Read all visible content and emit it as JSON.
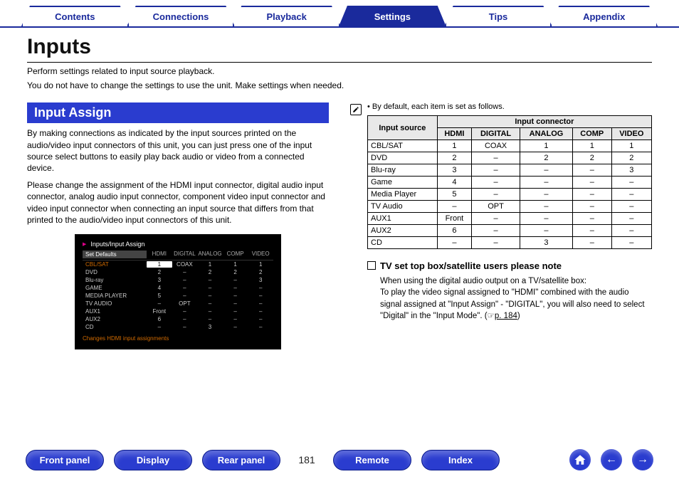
{
  "tabs": {
    "items": [
      "Contents",
      "Connections",
      "Playback",
      "Settings",
      "Tips",
      "Appendix"
    ],
    "active_index": 3
  },
  "page": {
    "title": "Inputs",
    "intro1": "Perform settings related to input source playback.",
    "intro2": "You do not have to change the settings to use the unit. Make settings when needed.",
    "number": "181"
  },
  "left": {
    "section_title": "Input Assign",
    "para1": "By making connections as indicated by the input sources printed on the audio/video input connectors of this unit, you can just press one of the input source select buttons to easily play back audio or video from a connected device.",
    "para2": "Please change the assignment of the HDMI input connector, digital audio input connector, analog audio input connector, component video input connector and video input connector when connecting an input source that differs from that printed to the audio/video input connectors of this unit."
  },
  "osd": {
    "title": "Inputs/Input Assign",
    "head": [
      "Set Defaults",
      "HDMI",
      "DIGITAL",
      "ANALOG",
      "COMP",
      "VIDEO"
    ],
    "rows": [
      {
        "label": "CBL/SAT",
        "c": [
          "1",
          "COAX",
          "1",
          "1",
          "1"
        ],
        "hl": true
      },
      {
        "label": "DVD",
        "c": [
          "2",
          "–",
          "2",
          "2",
          "2"
        ]
      },
      {
        "label": "Blu-ray",
        "c": [
          "3",
          "–",
          "–",
          "–",
          "3"
        ]
      },
      {
        "label": "GAME",
        "c": [
          "4",
          "–",
          "–",
          "–",
          "–"
        ]
      },
      {
        "label": "MEDIA PLAYER",
        "c": [
          "5",
          "–",
          "–",
          "–",
          "–"
        ]
      },
      {
        "label": "TV AUDIO",
        "c": [
          "–",
          "OPT",
          "–",
          "–",
          "–"
        ]
      },
      {
        "label": "AUX1",
        "c": [
          "Front",
          "–",
          "–",
          "–",
          "–"
        ]
      },
      {
        "label": "AUX2",
        "c": [
          "6",
          "–",
          "–",
          "–",
          "–"
        ]
      },
      {
        "label": "CD",
        "c": [
          "–",
          "–",
          "3",
          "–",
          "–"
        ]
      }
    ],
    "footer": "Changes HDMI input assignments"
  },
  "right": {
    "note": "By default, each item is set as follows.",
    "table": {
      "head_rowspan": "Input source",
      "head_colspan": "Input connector",
      "cols": [
        "HDMI",
        "DIGITAL",
        "ANALOG",
        "COMP",
        "VIDEO"
      ],
      "rows": [
        {
          "label": "CBL/SAT",
          "c": [
            "1",
            "COAX",
            "1",
            "1",
            "1"
          ]
        },
        {
          "label": "DVD",
          "c": [
            "2",
            "–",
            "2",
            "2",
            "2"
          ]
        },
        {
          "label": "Blu-ray",
          "c": [
            "3",
            "–",
            "–",
            "–",
            "3"
          ]
        },
        {
          "label": "Game",
          "c": [
            "4",
            "–",
            "–",
            "–",
            "–"
          ]
        },
        {
          "label": "Media Player",
          "c": [
            "5",
            "–",
            "–",
            "–",
            "–"
          ]
        },
        {
          "label": "TV Audio",
          "c": [
            "–",
            "OPT",
            "–",
            "–",
            "–"
          ]
        },
        {
          "label": "AUX1",
          "c": [
            "Front",
            "–",
            "–",
            "–",
            "–"
          ]
        },
        {
          "label": "AUX2",
          "c": [
            "6",
            "–",
            "–",
            "–",
            "–"
          ]
        },
        {
          "label": "CD",
          "c": [
            "–",
            "–",
            "3",
            "–",
            "–"
          ]
        }
      ]
    },
    "sub_title": "TV set top box/satellite users please note",
    "sub_body1": "When using the digital audio output on a TV/satellite box:",
    "sub_body2_a": "To play the video signal assigned to \"HDMI\" combined with the audio signal assigned at \"Input Assign\" - \"DIGITAL\", you will also need to select \"Digital\" in the \"Input Mode\".  (☞",
    "sub_body2_link": "p. 184",
    "sub_body2_b": ")"
  },
  "bottom": {
    "items": [
      "Front panel",
      "Display",
      "Rear panel"
    ],
    "items2": [
      "Remote",
      "Index"
    ]
  }
}
